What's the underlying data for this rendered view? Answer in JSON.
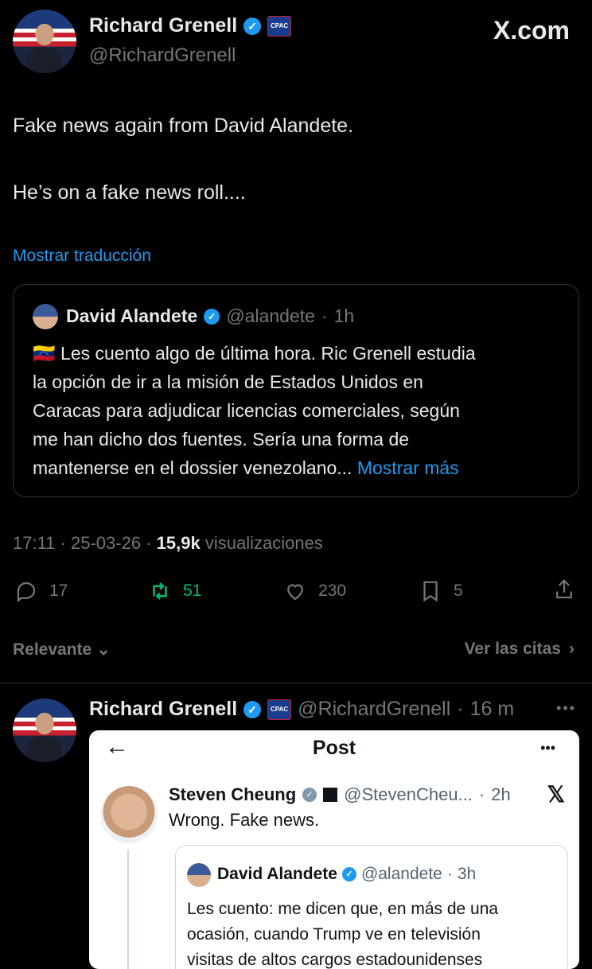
{
  "tweet": {
    "author_name": "Richard Grenell",
    "author_handle": "@RichardGrenell",
    "brand": "X.com",
    "badge": "CPAC",
    "text_line1": "Fake news again from David Alandete.",
    "text_line2": "He’s on a fake news roll....",
    "translate": "Mostrar traducción",
    "quote": {
      "name": "David Alandete",
      "handle": "@alandete",
      "time": "1h",
      "flag": "🇻🇪",
      "lines": [
        "Les cuento algo de última hora. Ric Grenell estudia",
        "la opción de ir a la misión de Estados Unidos en",
        "Caracas para adjudicar licencias comerciales, según",
        "me han dicho dos fuentes. Sería una forma de",
        "mantenerse en el dossier venezolano..."
      ],
      "show_more": "Mostrar más"
    },
    "meta": {
      "time": "17:11",
      "date": "25-03-26",
      "views_count": "15,9k",
      "views_label": "visualizaciones"
    },
    "actions": {
      "replies": "17",
      "reposts": "51",
      "likes": "230",
      "bookmarks": "5"
    },
    "sort_label": "Relevante",
    "quotes_link": "Ver las citas"
  },
  "reply": {
    "author_name": "Richard Grenell",
    "author_handle": "@RichardGrenell",
    "time": "16 m",
    "more": "•••",
    "badge": "CPAC",
    "screenshot": {
      "title": "Post",
      "more": "•••",
      "name": "Steven Cheung",
      "handle": "@StevenCheu...",
      "time": "2h",
      "text": "Wrong. Fake news.",
      "quote": {
        "name": "David Alandete",
        "handle": "@alandete",
        "time": "3h",
        "lines": [
          "Les cuento: me dicen que, en más de una",
          "ocasión, cuando Trump ve en televisión",
          "visitas de altos cargos estadounidenses"
        ]
      }
    }
  },
  "colors": {
    "accent": "#1d9bf0",
    "repost_green": "#00ba7c",
    "muted": "#71767b"
  }
}
